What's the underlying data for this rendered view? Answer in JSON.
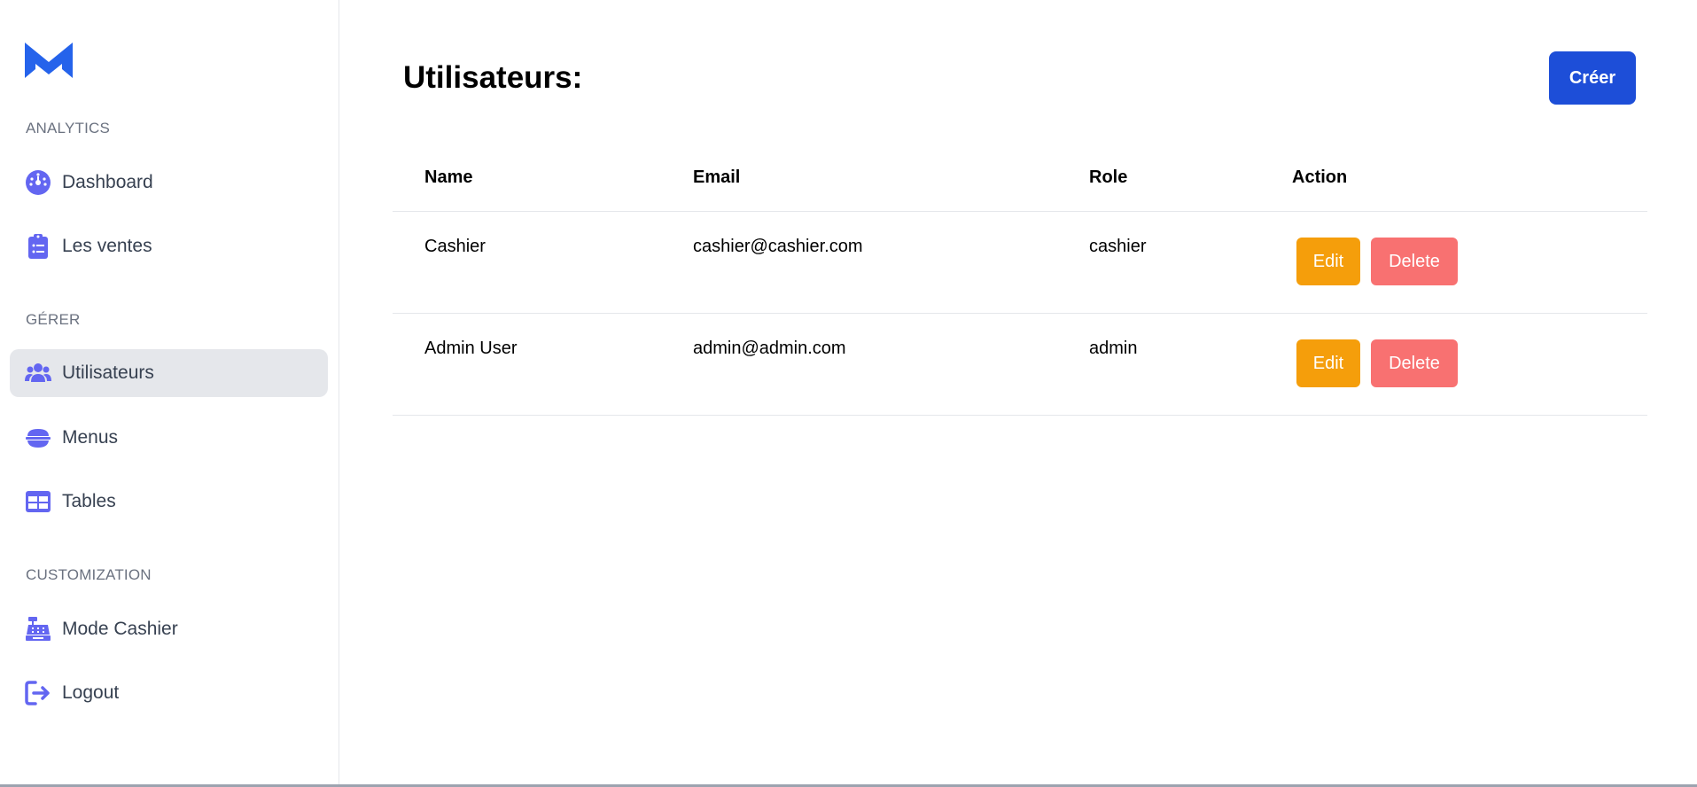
{
  "colors": {
    "accent": "#6366f1",
    "brand": "#2563eb",
    "primary_button": "#1d4ed8",
    "edit": "#f59e0b",
    "delete": "#f87171",
    "active_bg": "#e5e7eb"
  },
  "sidebar": {
    "logo_icon": "m-logo-icon",
    "sections": [
      {
        "label": "ANALYTICS",
        "items": [
          {
            "label": "Dashboard",
            "icon": "gauge-icon"
          },
          {
            "label": "Les ventes",
            "icon": "clipboard-list-icon"
          }
        ]
      },
      {
        "label": "GÉRER",
        "items": [
          {
            "label": "Utilisateurs",
            "icon": "users-icon",
            "active": true
          },
          {
            "label": "Menus",
            "icon": "bowl-icon"
          },
          {
            "label": "Tables",
            "icon": "table-icon"
          }
        ]
      },
      {
        "label": "CUSTOMIZATION",
        "items": [
          {
            "label": "Mode Cashier",
            "icon": "cash-register-icon"
          },
          {
            "label": "Logout",
            "icon": "logout-icon"
          }
        ]
      }
    ]
  },
  "main": {
    "title": "Utilisateurs:",
    "create_label": "Créer",
    "table": {
      "headers": [
        "Name",
        "Email",
        "Role",
        "Action"
      ],
      "rows": [
        {
          "name": "Cashier",
          "email": "cashier@cashier.com",
          "role": "cashier",
          "edit_label": "Edit",
          "delete_label": "Delete"
        },
        {
          "name": "Admin User",
          "email": "admin@admin.com",
          "role": "admin",
          "edit_label": "Edit",
          "delete_label": "Delete"
        }
      ]
    }
  }
}
